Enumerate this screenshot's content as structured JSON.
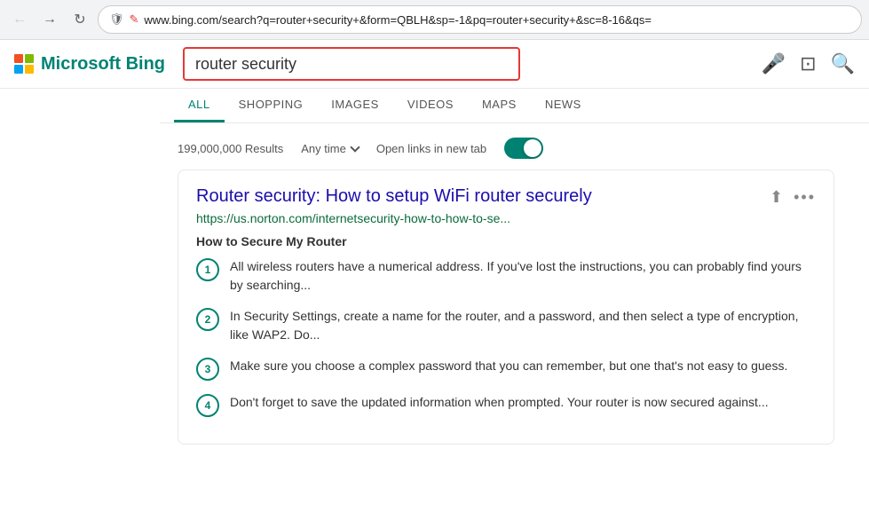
{
  "browser": {
    "back_btn": "←",
    "forward_btn": "→",
    "reload_btn": "↻",
    "url": "www.bing.com/search?q=router+security+&form=QBLH&sp=-1&pq=router+security+&sc=8-16&qs=",
    "shield_symbol": "🛡",
    "edit_symbol": "✎"
  },
  "header": {
    "logo_text_normal": "Microsoft ",
    "logo_text_bold": "Bing",
    "search_query": "router security",
    "mic_icon": "🎤",
    "camera_icon": "⊡",
    "search_icon": "🔍"
  },
  "nav_tabs": [
    {
      "id": "all",
      "label": "ALL",
      "active": true
    },
    {
      "id": "shopping",
      "label": "SHOPPING",
      "active": false
    },
    {
      "id": "images",
      "label": "IMAGES",
      "active": false
    },
    {
      "id": "videos",
      "label": "VIDEOS",
      "active": false
    },
    {
      "id": "maps",
      "label": "MAPS",
      "active": false
    },
    {
      "id": "news",
      "label": "NEWS",
      "active": false
    }
  ],
  "results_meta": {
    "count": "199,000,000 Results",
    "filter_label": "Any time",
    "open_links_label": "Open links in new tab",
    "toggle_on": true
  },
  "search_result": {
    "title": "Router security: How to setup WiFi router securely",
    "url": "https://us.norton.com/internetsecurity-how-to-how-to-se...",
    "subtitle": "How to Secure My Router",
    "steps": [
      {
        "number": "1",
        "text": "All wireless routers have a numerical address. If you've lost the instructions, you can probably find yours by searching..."
      },
      {
        "number": "2",
        "text": "In Security Settings, create a name for the router, and a password, and then select a type of encryption, like WAP2. Do..."
      },
      {
        "number": "3",
        "text": "Make sure you choose a complex password that you can remember, but one that's not easy to guess."
      },
      {
        "number": "4",
        "text": "Don't forget to save the updated information when prompted. Your router is now secured against..."
      }
    ],
    "share_icon": "⬆",
    "more_icon": "•••"
  }
}
